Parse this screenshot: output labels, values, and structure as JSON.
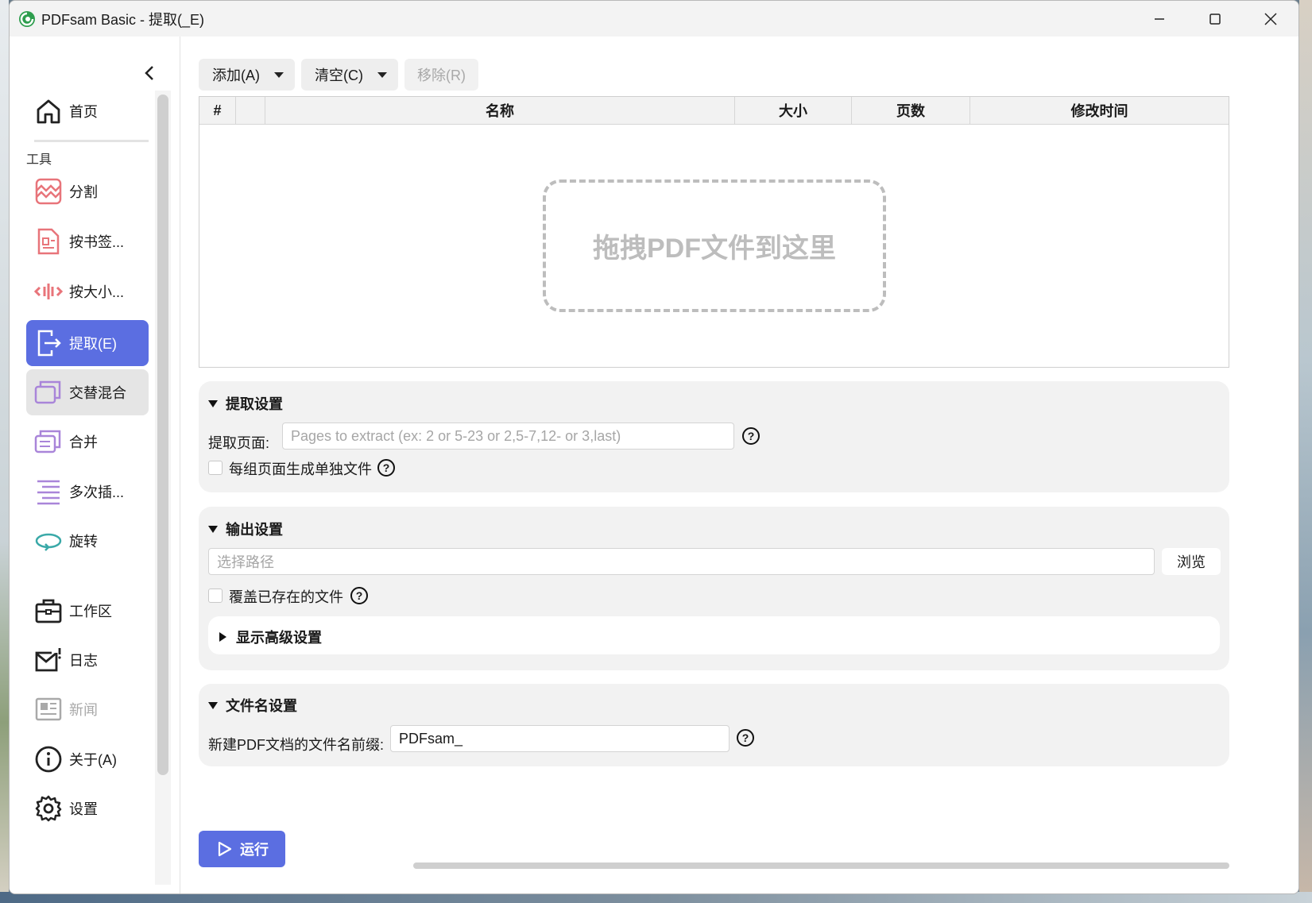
{
  "window": {
    "title": "PDFsam Basic - 提取(_E)"
  },
  "sidebar": {
    "home_label": "首页",
    "tools_section": "工具",
    "items": [
      {
        "label": "分割",
        "icon": "split-icon"
      },
      {
        "label": "按书签...",
        "icon": "split-by-bookmarks-icon"
      },
      {
        "label": "按大小...",
        "icon": "split-by-size-icon"
      },
      {
        "label": "提取(E)",
        "icon": "extract-icon",
        "state": "active"
      },
      {
        "label": "交替混合",
        "icon": "alternate-mix-icon",
        "state": "hover"
      },
      {
        "label": "合并",
        "icon": "merge-icon"
      },
      {
        "label": "多次插...",
        "icon": "multiple-insert-icon"
      },
      {
        "label": "旋转",
        "icon": "rotate-icon"
      }
    ],
    "bottom": [
      {
        "label": "工作区",
        "icon": "workspace-icon"
      },
      {
        "label": "日志",
        "icon": "log-icon"
      },
      {
        "label": "新闻",
        "icon": "news-icon",
        "state": "disabled"
      },
      {
        "label": "关于(A)",
        "icon": "about-icon"
      },
      {
        "label": "设置",
        "icon": "settings-icon"
      }
    ]
  },
  "toolbar": {
    "add_label": "添加(A)",
    "clear_label": "清空(C)",
    "remove_label": "移除(R)"
  },
  "table": {
    "columns": [
      "#",
      "",
      "名称",
      "大小",
      "页数",
      "修改时间"
    ],
    "drop_hint": "拖拽PDF文件到这里"
  },
  "extract_settings": {
    "title": "提取设置",
    "pages_label": "提取页面:",
    "pages_placeholder": "Pages to extract (ex: 2 or 5-23 or 2,5-7,12- or 3,last)",
    "separate_label": "每组页面生成单独文件"
  },
  "output_settings": {
    "title": "输出设置",
    "path_placeholder": "选择路径",
    "browse_label": "浏览",
    "overwrite_label": "覆盖已存在的文件",
    "advanced_label": "显示高级设置"
  },
  "filename_settings": {
    "title": "文件名设置",
    "prefix_label": "新建PDF文档的文件名前缀:",
    "prefix_value": "PDFsam_"
  },
  "run_label": "运行",
  "colors": {
    "accent": "#5b6ee1",
    "split_icon": "#e8747a",
    "merge_icon": "#a985d9",
    "rotate_icon": "#3aa9a8"
  }
}
